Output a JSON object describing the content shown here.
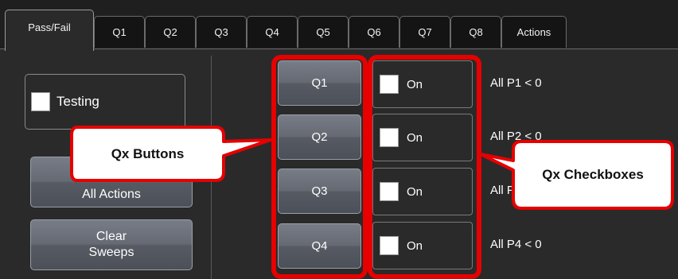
{
  "tabs": [
    {
      "label": "Pass/Fail",
      "active": true
    },
    {
      "label": "Q1",
      "active": false
    },
    {
      "label": "Q2",
      "active": false
    },
    {
      "label": "Q3",
      "active": false
    },
    {
      "label": "Q4",
      "active": false
    },
    {
      "label": "Q5",
      "active": false
    },
    {
      "label": "Q6",
      "active": false
    },
    {
      "label": "Q7",
      "active": false
    },
    {
      "label": "Q8",
      "active": false
    },
    {
      "label": "Actions",
      "active": false
    }
  ],
  "left": {
    "testing_label": "Testing",
    "testing_checked": false,
    "arm_label": "All Actions",
    "clear_label_line1": "Clear",
    "clear_label_line2": "Sweeps"
  },
  "queries": [
    {
      "button": "Q1",
      "checkbox_label": "On",
      "checked": false,
      "condition": "All P1 < 0"
    },
    {
      "button": "Q2",
      "checkbox_label": "On",
      "checked": false,
      "condition": "All P2 < 0"
    },
    {
      "button": "Q3",
      "checkbox_label": "On",
      "checked": false,
      "condition": "All P3 < 0"
    },
    {
      "button": "Q4",
      "checkbox_label": "On",
      "checked": false,
      "condition": "All P4 < 0"
    }
  ],
  "annotations": {
    "buttons_callout": "Qx Buttons",
    "checkboxes_callout": "Qx Checkboxes",
    "highlight_color": "#e60000"
  },
  "colors": {
    "panel_bg": "#2a2a2a",
    "tab_bg": "#141414",
    "button_gradient_top": "#777c86",
    "button_gradient_bottom": "#4c5058"
  }
}
